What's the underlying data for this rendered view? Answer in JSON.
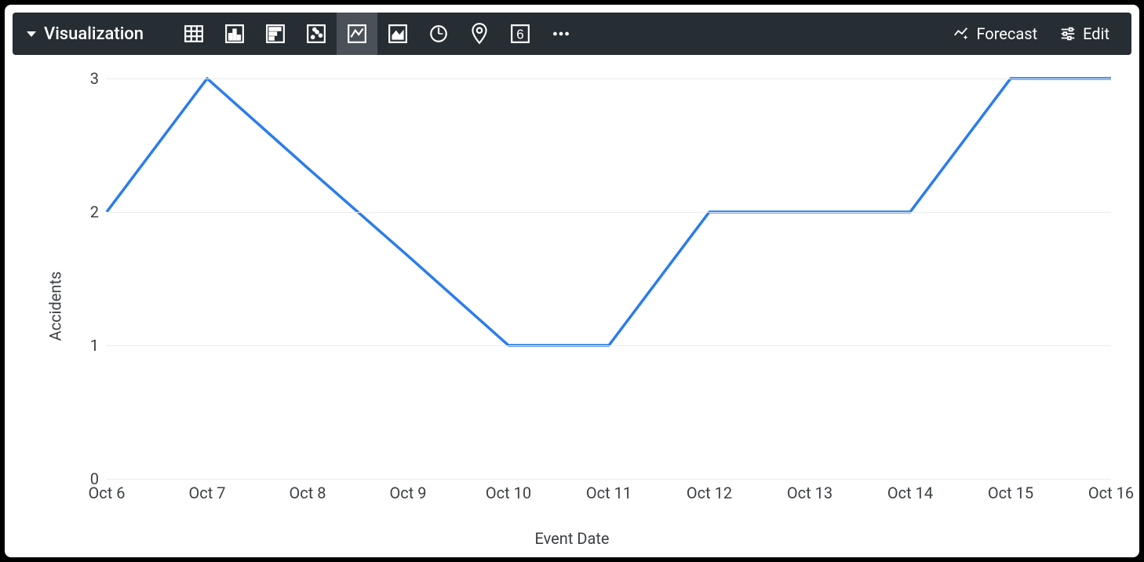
{
  "toolbar": {
    "title": "Visualization",
    "forecast_label": "Forecast",
    "edit_label": "Edit",
    "icons_semantic": [
      "table",
      "bar",
      "horizontal-bar",
      "scatter",
      "line",
      "area",
      "gauge",
      "map",
      "single-value",
      "more"
    ]
  },
  "chart_data": {
    "type": "line",
    "categories": [
      "Oct 6",
      "Oct 7",
      "Oct 8",
      "Oct 9",
      "Oct 10",
      "Oct 11",
      "Oct 12",
      "Oct 13",
      "Oct 14",
      "Oct 15",
      "Oct 16"
    ],
    "values": [
      2,
      3,
      2.33,
      1.67,
      1,
      1,
      2,
      2,
      2,
      3,
      3
    ],
    "ylabel": "Accidents",
    "xlabel": "Event Date",
    "ylim": [
      0,
      3
    ],
    "y_ticks": [
      0,
      1,
      2,
      3
    ],
    "line_color": "#2b7de9"
  }
}
